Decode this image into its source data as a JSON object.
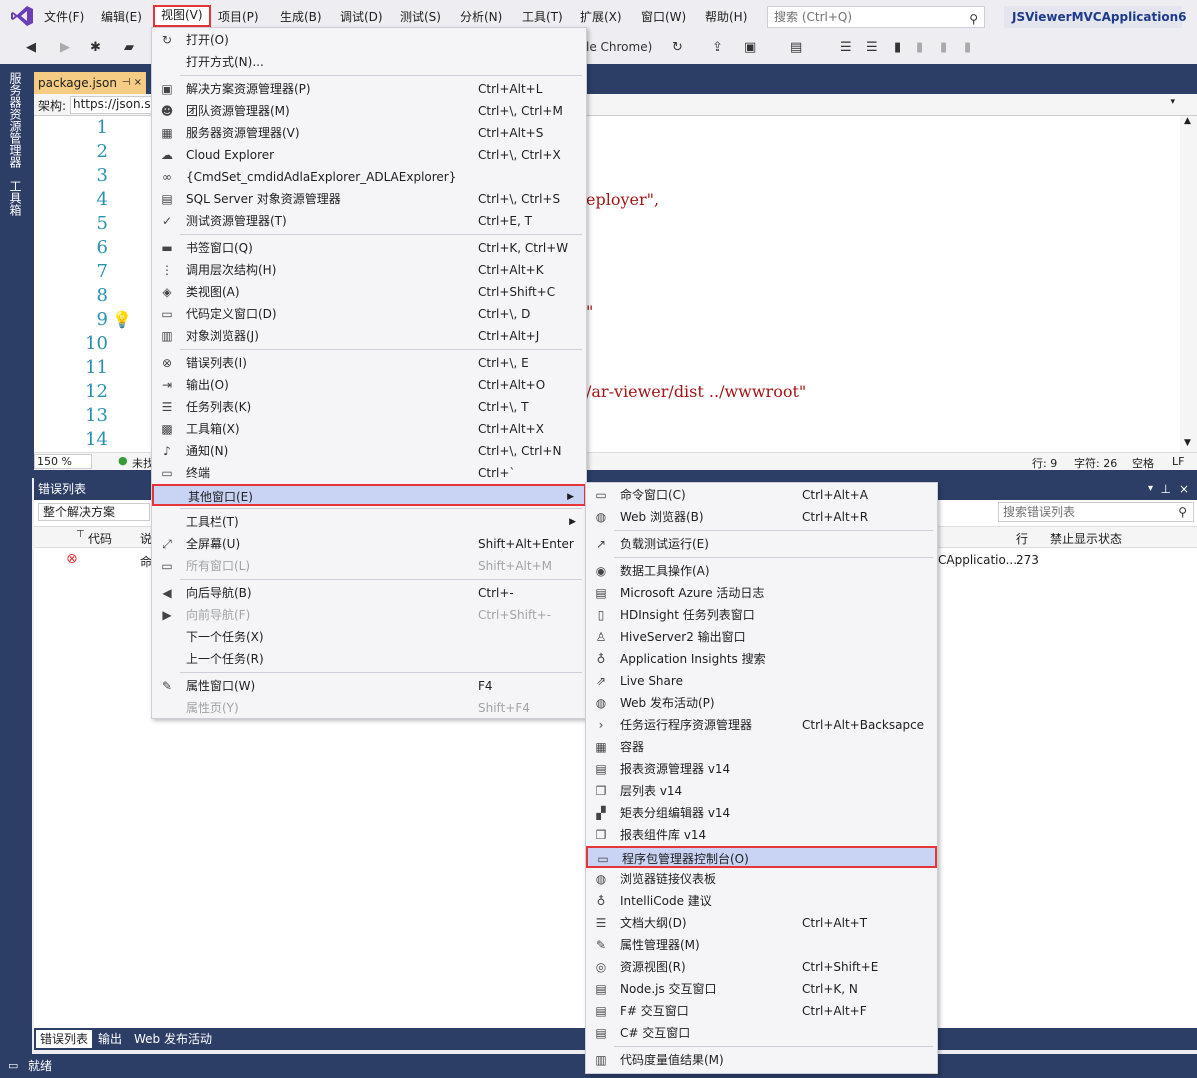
{
  "menubar": {
    "items": [
      "文件(F)",
      "编辑(E)",
      "视图(V)",
      "项目(P)",
      "生成(B)",
      "调试(D)",
      "测试(S)",
      "分析(N)",
      "工具(T)",
      "扩展(X)",
      "窗口(W)",
      "帮助(H)"
    ],
    "search_placeholder": "搜索 (Ctrl+Q)",
    "project_name": "JSViewerMVCApplication6"
  },
  "toolbar": {
    "browser_label": "le Chrome)"
  },
  "left_strip": {
    "tab1": "服务器资源管理器",
    "tab2": "工具箱"
  },
  "document": {
    "tab_label": "package.json",
    "tab_pin": "⊣ ×",
    "schema_label": "架构:",
    "schema_value": "https://json.sc",
    "line_numbers": [
      "1",
      "2",
      "3",
      "4",
      "5",
      "6",
      "7",
      "8",
      "9",
      "10",
      "11",
      "12",
      "13",
      "14"
    ],
    "code_fragments": {
      "line4": "eployer\",",
      "line9": "\"",
      "line12": "/ar-viewer/dist ../wwwroot\""
    },
    "zoom": "150 %",
    "status_left": "未找",
    "row_label": "行: 9",
    "col_label": "字符: 26",
    "space_label": "空格",
    "eol_label": "LF"
  },
  "error_list": {
    "title": "错误列表",
    "scope": "整个解决方案",
    "search_placeholder": "搜索错误列表",
    "col_code": "代码",
    "col_desc": "说",
    "col_line": "行",
    "col_suppress": "禁止显示状态",
    "row_desc": "命",
    "row_project": "CApplicatio...",
    "row_line": "273"
  },
  "bottom_tabs": [
    "错误列表",
    "输出",
    "Web 发布活动"
  ],
  "statusbar": {
    "text": "就绪"
  },
  "view_menu": {
    "items": [
      {
        "label": "打开(O)",
        "shortcut": "",
        "icon": "↻"
      },
      {
        "label": "打开方式(N)...",
        "shortcut": "",
        "icon": ""
      },
      {
        "sep": true
      },
      {
        "label": "解决方案资源管理器(P)",
        "shortcut": "Ctrl+Alt+L",
        "icon": "▣"
      },
      {
        "label": "团队资源管理器(M)",
        "shortcut": "Ctrl+\\, Ctrl+M",
        "icon": "☻"
      },
      {
        "label": "服务器资源管理器(V)",
        "shortcut": "Ctrl+Alt+S",
        "icon": "▦"
      },
      {
        "label": "Cloud Explorer",
        "shortcut": "Ctrl+\\, Ctrl+X",
        "icon": "☁"
      },
      {
        "label": "{CmdSet_cmdidAdlaExplorer_ADLAExplorer}",
        "shortcut": "",
        "icon": "∞"
      },
      {
        "label": "SQL Server 对象资源管理器",
        "shortcut": "Ctrl+\\, Ctrl+S",
        "icon": "▤"
      },
      {
        "label": "测试资源管理器(T)",
        "shortcut": "Ctrl+E, T",
        "icon": "✓"
      },
      {
        "sep": true
      },
      {
        "label": "书签窗口(Q)",
        "shortcut": "Ctrl+K, Ctrl+W",
        "icon": "▬"
      },
      {
        "label": "调用层次结构(H)",
        "shortcut": "Ctrl+Alt+K",
        "icon": "⋮"
      },
      {
        "label": "类视图(A)",
        "shortcut": "Ctrl+Shift+C",
        "icon": "◈"
      },
      {
        "label": "代码定义窗口(D)",
        "shortcut": "Ctrl+\\, D",
        "icon": "▭"
      },
      {
        "label": "对象浏览器(J)",
        "shortcut": "Ctrl+Alt+J",
        "icon": "▥"
      },
      {
        "sep": true
      },
      {
        "label": "错误列表(I)",
        "shortcut": "Ctrl+\\, E",
        "icon": "⊗"
      },
      {
        "label": "输出(O)",
        "shortcut": "Ctrl+Alt+O",
        "icon": "⇥"
      },
      {
        "label": "任务列表(K)",
        "shortcut": "Ctrl+\\, T",
        "icon": "☰"
      },
      {
        "label": "工具箱(X)",
        "shortcut": "Ctrl+Alt+X",
        "icon": "▩"
      },
      {
        "label": "通知(N)",
        "shortcut": "Ctrl+\\, Ctrl+N",
        "icon": "♪"
      },
      {
        "label": "终端",
        "shortcut": "Ctrl+`",
        "icon": "▭"
      },
      {
        "label": "其他窗口(E)",
        "shortcut": "",
        "icon": "",
        "submenu": true,
        "highlighted": true
      },
      {
        "sep": true
      },
      {
        "label": "工具栏(T)",
        "shortcut": "",
        "icon": "",
        "submenu": true
      },
      {
        "label": "全屏幕(U)",
        "shortcut": "Shift+Alt+Enter",
        "icon": "⤢"
      },
      {
        "label": "所有窗口(L)",
        "shortcut": "Shift+Alt+M",
        "icon": "▭",
        "disabled": true
      },
      {
        "sep": true
      },
      {
        "label": "向后导航(B)",
        "shortcut": "Ctrl+-",
        "icon": "◀"
      },
      {
        "label": "向前导航(F)",
        "shortcut": "Ctrl+Shift+-",
        "icon": "▶",
        "disabled": true
      },
      {
        "label": "下一个任务(X)",
        "shortcut": "",
        "icon": ""
      },
      {
        "label": "上一个任务(R)",
        "shortcut": "",
        "icon": ""
      },
      {
        "sep": true
      },
      {
        "label": "属性窗口(W)",
        "shortcut": "F4",
        "icon": "✎"
      },
      {
        "label": "属性页(Y)",
        "shortcut": "Shift+F4",
        "icon": "",
        "disabled": true
      }
    ]
  },
  "other_windows_menu": {
    "items": [
      {
        "label": "命令窗口(C)",
        "shortcut": "Ctrl+Alt+A",
        "icon": "▭"
      },
      {
        "label": "Web 浏览器(B)",
        "shortcut": "Ctrl+Alt+R",
        "icon": "◍"
      },
      {
        "sep": true
      },
      {
        "label": "负载测试运行(E)",
        "shortcut": "",
        "icon": "↗"
      },
      {
        "sep": true
      },
      {
        "label": "数据工具操作(A)",
        "shortcut": "",
        "icon": "◉"
      },
      {
        "label": "Microsoft Azure 活动日志",
        "shortcut": "",
        "icon": "▤"
      },
      {
        "label": "HDInsight 任务列表窗口",
        "shortcut": "",
        "icon": "▯"
      },
      {
        "label": "HiveServer2 输出窗口",
        "shortcut": "",
        "icon": "♙"
      },
      {
        "label": "Application Insights 搜索",
        "shortcut": "",
        "icon": "♁"
      },
      {
        "label": "Live Share",
        "shortcut": "",
        "icon": "⇗"
      },
      {
        "label": "Web 发布活动(P)",
        "shortcut": "",
        "icon": "◍"
      },
      {
        "label": "任务运行程序资源管理器",
        "shortcut": "Ctrl+Alt+Backsapce",
        "icon": "›"
      },
      {
        "label": "容器",
        "shortcut": "",
        "icon": "▦"
      },
      {
        "label": "报表资源管理器 v14",
        "shortcut": "",
        "icon": "▤"
      },
      {
        "label": "层列表 v14",
        "shortcut": "",
        "icon": "❐"
      },
      {
        "label": "矩表分组编辑器 v14",
        "shortcut": "",
        "icon": "▞"
      },
      {
        "label": "报表组件库 v14",
        "shortcut": "",
        "icon": "❐"
      },
      {
        "label": "程序包管理器控制台(O)",
        "shortcut": "",
        "icon": "▭",
        "highlighted": true
      },
      {
        "label": "浏览器链接仪表板",
        "shortcut": "",
        "icon": "◍"
      },
      {
        "label": "IntelliCode 建议",
        "shortcut": "",
        "icon": "♁"
      },
      {
        "label": "文档大纲(D)",
        "shortcut": "Ctrl+Alt+T",
        "icon": "☰"
      },
      {
        "label": "属性管理器(M)",
        "shortcut": "",
        "icon": "✎"
      },
      {
        "label": "资源视图(R)",
        "shortcut": "Ctrl+Shift+E",
        "icon": "◎"
      },
      {
        "label": "Node.js 交互窗口",
        "shortcut": "Ctrl+K, N",
        "icon": "▤"
      },
      {
        "label": "F# 交互窗口",
        "shortcut": "Ctrl+Alt+F",
        "icon": "▤"
      },
      {
        "label": "C# 交互窗口",
        "shortcut": "",
        "icon": "▤"
      },
      {
        "sep": true
      },
      {
        "label": "代码度量值结果(M)",
        "shortcut": "",
        "icon": "▥"
      }
    ]
  }
}
